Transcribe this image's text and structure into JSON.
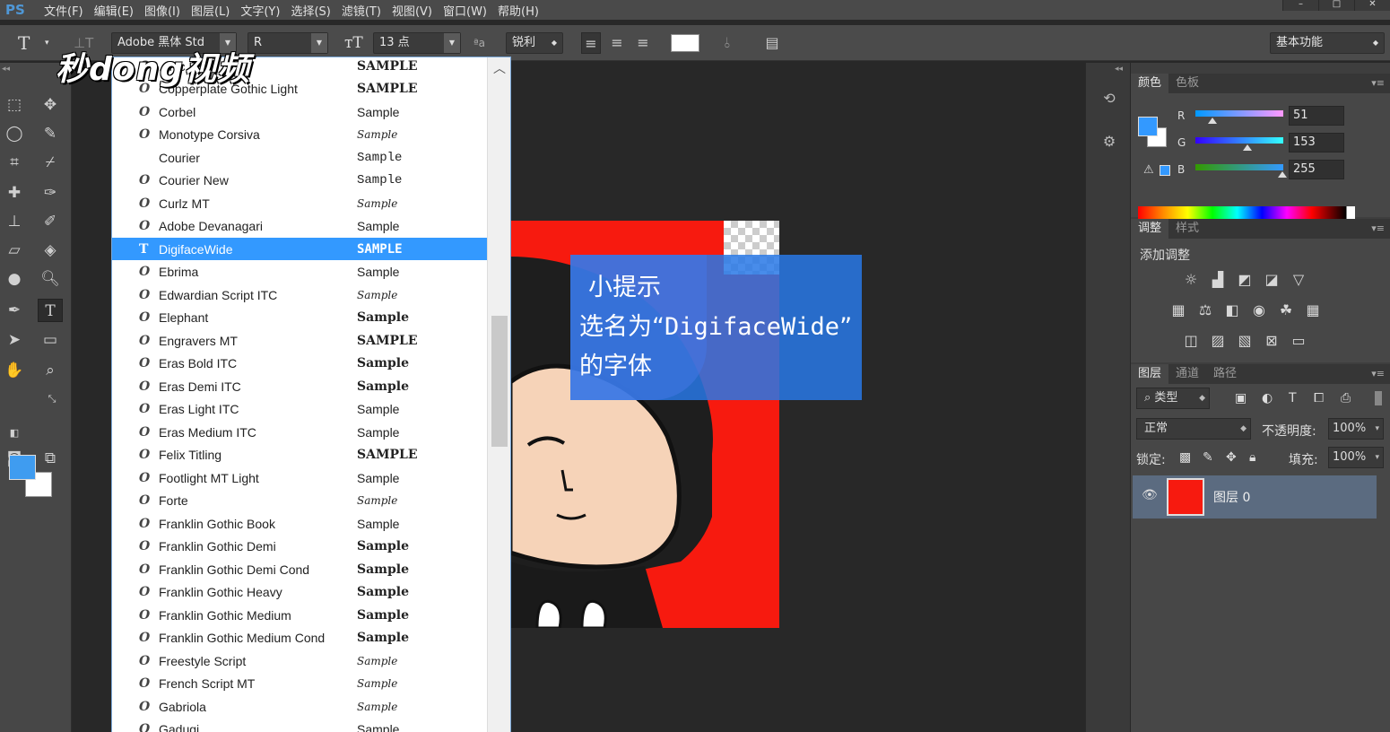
{
  "app": {
    "logo": "PS"
  },
  "menu": [
    "文件(F)",
    "编辑(E)",
    "图像(I)",
    "图层(L)",
    "文字(Y)",
    "选择(S)",
    "滤镜(T)",
    "视图(V)",
    "窗口(W)",
    "帮助(H)"
  ],
  "options_bar": {
    "font_family": "Adobe 黑体 Std",
    "font_style": "R",
    "font_size": "13 点",
    "antialias": "锐利",
    "workspace": "基本功能"
  },
  "watermark": "秒dong视频",
  "font_list": {
    "items": [
      {
        "name": "...hic Bold",
        "sample": "SAMPLE",
        "icon": "opentype"
      },
      {
        "name": "Copperplate Gothic Light",
        "sample": "SAMPLE",
        "icon": "opentype"
      },
      {
        "name": "Corbel",
        "sample": "Sample",
        "icon": "opentype"
      },
      {
        "name": "Monotype Corsiva",
        "sample": "Sample",
        "icon": "opentype"
      },
      {
        "name": "Courier",
        "sample": "Sample",
        "icon": ""
      },
      {
        "name": "Courier New",
        "sample": "Sample",
        "icon": "opentype"
      },
      {
        "name": "Curlz MT",
        "sample": "Sample",
        "icon": "opentype"
      },
      {
        "name": "Adobe Devanagari",
        "sample": "Sample",
        "icon": "opentype"
      },
      {
        "name": "DigifaceWide",
        "sample": "SAMPLE",
        "icon": "truetype",
        "selected": true
      },
      {
        "name": "Ebrima",
        "sample": "Sample",
        "icon": "opentype"
      },
      {
        "name": "Edwardian Script ITC",
        "sample": "Sample",
        "icon": "opentype"
      },
      {
        "name": "Elephant",
        "sample": "Sample",
        "icon": "opentype"
      },
      {
        "name": "Engravers MT",
        "sample": "SAMPLE",
        "icon": "opentype"
      },
      {
        "name": "Eras Bold ITC",
        "sample": "Sample",
        "icon": "opentype"
      },
      {
        "name": "Eras Demi ITC",
        "sample": "Sample",
        "icon": "opentype"
      },
      {
        "name": "Eras Light ITC",
        "sample": "Sample",
        "icon": "opentype"
      },
      {
        "name": "Eras Medium ITC",
        "sample": "Sample",
        "icon": "opentype"
      },
      {
        "name": "Felix Titling",
        "sample": "SAMPLE",
        "icon": "opentype"
      },
      {
        "name": "Footlight MT Light",
        "sample": "Sample",
        "icon": "opentype"
      },
      {
        "name": "Forte",
        "sample": "Sample",
        "icon": "opentype"
      },
      {
        "name": "Franklin Gothic Book",
        "sample": "Sample",
        "icon": "opentype"
      },
      {
        "name": "Franklin Gothic Demi",
        "sample": "Sample",
        "icon": "opentype"
      },
      {
        "name": "Franklin Gothic Demi Cond",
        "sample": "Sample",
        "icon": "opentype"
      },
      {
        "name": "Franklin Gothic Heavy",
        "sample": "Sample",
        "icon": "opentype"
      },
      {
        "name": "Franklin Gothic Medium",
        "sample": "Sample",
        "icon": "opentype"
      },
      {
        "name": "Franklin Gothic Medium Cond",
        "sample": "Sample",
        "icon": "opentype"
      },
      {
        "name": "Freestyle Script",
        "sample": "Sample",
        "icon": "opentype"
      },
      {
        "name": "French Script MT",
        "sample": "Sample",
        "icon": "opentype"
      },
      {
        "name": "Gabriola",
        "sample": "Sample",
        "icon": "opentype"
      },
      {
        "name": "Gadugi",
        "sample": "Sample",
        "icon": "opentype"
      }
    ]
  },
  "tip": {
    "line1": "小提示",
    "line2_prefix": "选名为“",
    "line2_font": "DigifaceWide",
    "line2_suffix": "”",
    "line3": "的字体"
  },
  "color_panel": {
    "tabs": [
      "颜色",
      "色板"
    ],
    "r_label": "R",
    "g_label": "G",
    "b_label": "B",
    "r": "51",
    "g": "153",
    "b": "255",
    "fg_color": "#3399ff"
  },
  "adjust_panel": {
    "tabs": [
      "调整",
      "样式"
    ],
    "title": "添加调整"
  },
  "layers_panel": {
    "tabs": [
      "图层",
      "通道",
      "路径"
    ],
    "filter_label": "类型",
    "blend_mode": "正常",
    "opacity_label": "不透明度:",
    "opacity": "100%",
    "lock_label": "锁定:",
    "fill_label": "填充:",
    "fill": "100%",
    "layer_name": "图层 0"
  }
}
